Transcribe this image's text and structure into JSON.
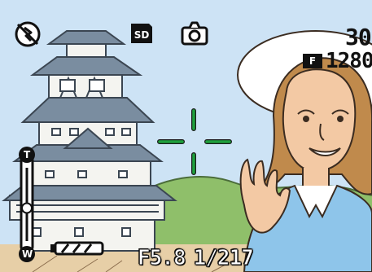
{
  "status_bar": {
    "flash_mode_icon": "flash-off-icon",
    "storage_icon": "sd-card-icon",
    "storage_label": "SD",
    "mode_icon": "still-camera-icon",
    "shots_remaining": "30",
    "quality_icon": "fine-quality-icon",
    "quality_label": "F",
    "resolution": "1280"
  },
  "zoom_bar": {
    "tele_label": "T",
    "wide_label": "W",
    "level": 0.55
  },
  "battery": {
    "icon": "battery-full-icon",
    "level": 1.0
  },
  "exposure": {
    "aperture": "F5.8",
    "shutter": "1/217"
  },
  "focus": {
    "icon": "af-target-icon",
    "color": "#1ea03c"
  },
  "colors": {
    "sky": "#cde3f5",
    "hill": "#8fbf6a",
    "castle_roof": "#7a8da0",
    "castle_wall": "#f4f4f0",
    "skin": "#f3c9a4",
    "hair": "#c08a4c",
    "shirt": "#8ec5ea"
  }
}
